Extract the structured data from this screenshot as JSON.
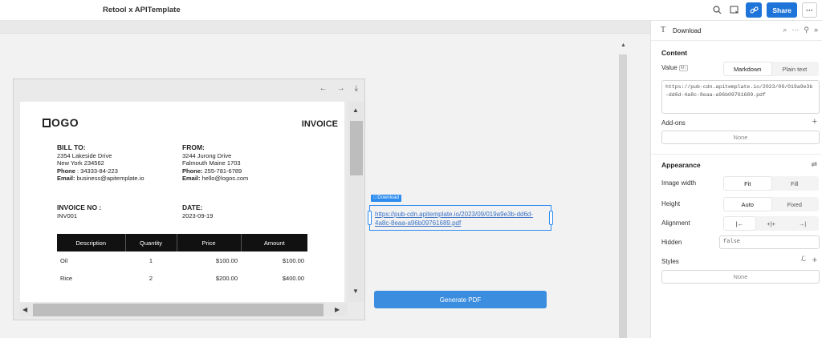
{
  "header": {
    "app_title": "Retool x APITemplate",
    "share_label": "Share",
    "more_label": "···"
  },
  "invoice": {
    "logo_text": "OGO",
    "title": "INVOICE",
    "bill_to": {
      "heading": "BILL TO:",
      "line1": "2354 Lakeside Drive",
      "line2": "New York 234562",
      "phone_label": "Phone",
      "phone": ": 34333-84-223",
      "email_label": "Email:",
      "email": " business@apitemplate.io"
    },
    "from": {
      "heading": "FROM:",
      "line1": "3244 Jurong Drive",
      "line2": "Falmouth Maine 1703",
      "phone_label": "Phone:",
      "phone": " 255-781-6789",
      "email_label": "Email:",
      "email": " hello@logos.com"
    },
    "invoice_no_label": "INVOICE NO :",
    "invoice_no": "INV001",
    "date_label": "DATE:",
    "date": "2023-09-19",
    "columns": [
      "Description",
      "Quantity",
      "Price",
      "Amount"
    ],
    "rows": [
      {
        "description": "Oil",
        "quantity": "1",
        "price": "$100.00",
        "amount": "$100.00"
      },
      {
        "description": "Rice",
        "quantity": "2",
        "price": "$200.00",
        "amount": "$400.00"
      }
    ]
  },
  "download": {
    "tag": "□ Download",
    "link_text": "https://pub-cdn.apitemplate.io/2023/09/019a9e3b-dd6d-4a8c-8eaa-a96b09761689.pdf"
  },
  "generate_button_label": "Generate PDF",
  "inspector": {
    "component_name": "Download",
    "content_title": "Content",
    "value_label": "Value",
    "value_badge": "M↓",
    "format_options": [
      "Markdown",
      "Plain text"
    ],
    "format_selected": "Markdown",
    "value_text": "https://pub-cdn.apitemplate.io/2023/09/019a9e3b-dd6d-4a8c-8eaa-a96b09761689.pdf",
    "addons_label": "Add-ons",
    "addons_value": "None",
    "appearance_title": "Appearance",
    "image_width_label": "Image width",
    "image_width_options": [
      "Fit",
      "Fill"
    ],
    "image_width_selected": "Fit",
    "height_label": "Height",
    "height_options": [
      "Auto",
      "Fixed"
    ],
    "height_selected": "Auto",
    "alignment_label": "Alignment",
    "alignment_options": [
      "|←",
      "+|+",
      "→|"
    ],
    "hidden_label": "Hidden",
    "hidden_value": "false",
    "styles_label": "Styles",
    "styles_value": "None"
  }
}
